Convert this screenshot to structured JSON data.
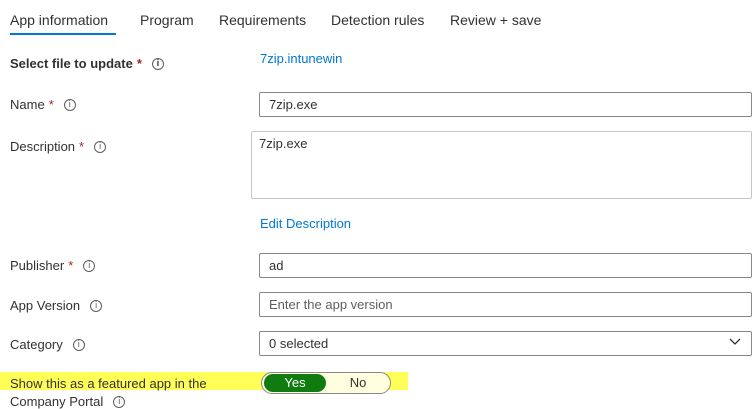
{
  "tabs": [
    {
      "label": "App information",
      "active": true
    },
    {
      "label": "Program"
    },
    {
      "label": "Requirements"
    },
    {
      "label": "Detection rules"
    },
    {
      "label": "Review + save"
    }
  ],
  "form": {
    "select_file": {
      "label": "Select file to update",
      "required_mark": "*",
      "file_name": "7zip.intunewin"
    },
    "name": {
      "label": "Name",
      "required_mark": "*",
      "value": "7zip.exe"
    },
    "description": {
      "label": "Description",
      "required_mark": "*",
      "value": "7zip.exe",
      "edit_link": "Edit Description"
    },
    "publisher": {
      "label": "Publisher",
      "required_mark": "*",
      "value": "ad"
    },
    "app_version": {
      "label": "App Version",
      "value": "",
      "placeholder": "Enter the app version"
    },
    "category": {
      "label": "Category",
      "value": "0 selected"
    },
    "featured": {
      "label_line1": "Show this as a featured app in the",
      "label_line2": "Company Portal",
      "yes": "Yes",
      "no": "No",
      "selected": "Yes"
    }
  },
  "colors": {
    "accent": "#0078d4",
    "required": "#a4262c",
    "toggle_on": "#107c10",
    "highlight": "#ffff3b"
  },
  "icons": {
    "info": "info-icon",
    "dropdown": "chevron-down-icon"
  }
}
